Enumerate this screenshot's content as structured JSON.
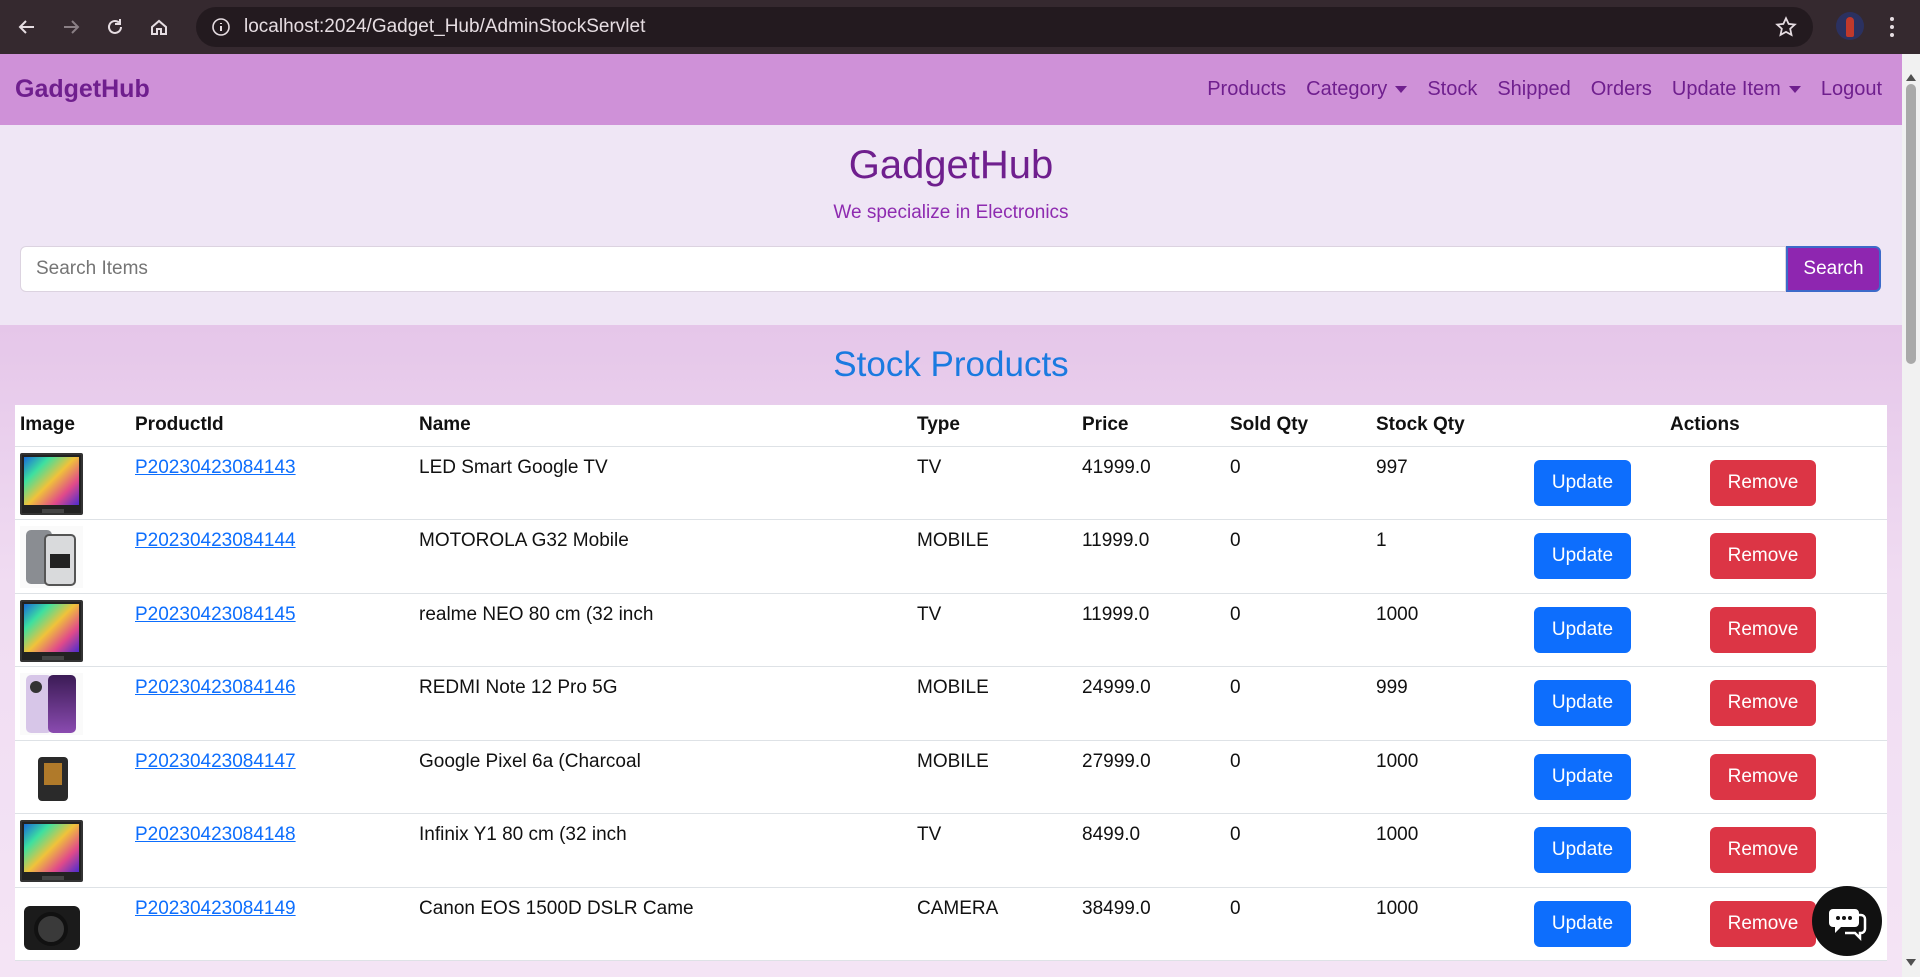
{
  "browser": {
    "url": "localhost:2024/Gadget_Hub/AdminStockServlet"
  },
  "navbar": {
    "brand": "GadgetHub",
    "links": {
      "products": "Products",
      "category": "Category",
      "stock": "Stock",
      "shipped": "Shipped",
      "orders": "Orders",
      "update_item": "Update Item",
      "logout": "Logout"
    }
  },
  "hero": {
    "title": "GadgetHub",
    "subtitle": "We specialize in Electronics",
    "search_placeholder": "Search Items",
    "search_button": "Search"
  },
  "stock": {
    "title": "Stock Products",
    "columns": {
      "image": "Image",
      "product_id": "ProductId",
      "name": "Name",
      "type": "Type",
      "price": "Price",
      "sold_qty": "Sold Qty",
      "stock_qty": "Stock Qty",
      "actions": "Actions"
    },
    "update_label": "Update",
    "remove_label": "Remove",
    "rows": [
      {
        "id": "P20230423084143",
        "name": "LED Smart Google TV",
        "type": "TV",
        "price": "41999.0",
        "sold": "0",
        "stock": "997",
        "thumb": "tv"
      },
      {
        "id": "P20230423084144",
        "name": "MOTOROLA G32 Mobile",
        "type": "MOBILE",
        "price": "11999.0",
        "sold": "0",
        "stock": "1",
        "thumb": "phone-grey"
      },
      {
        "id": "P20230423084145",
        "name": "realme NEO 80 cm (32 inch",
        "type": "TV",
        "price": "11999.0",
        "sold": "0",
        "stock": "1000",
        "thumb": "tv"
      },
      {
        "id": "P20230423084146",
        "name": "REDMI Note 12 Pro 5G",
        "type": "MOBILE",
        "price": "24999.0",
        "sold": "0",
        "stock": "999",
        "thumb": "phone-purple"
      },
      {
        "id": "P20230423084147",
        "name": "Google Pixel 6a (Charcoal",
        "type": "MOBILE",
        "price": "27999.0",
        "sold": "0",
        "stock": "1000",
        "thumb": "phone-dark"
      },
      {
        "id": "P20230423084148",
        "name": "Infinix Y1 80 cm (32 inch",
        "type": "TV",
        "price": "8499.0",
        "sold": "0",
        "stock": "1000",
        "thumb": "tv"
      },
      {
        "id": "P20230423084149",
        "name": "Canon EOS 1500D DSLR Came",
        "type": "CAMERA",
        "price": "38499.0",
        "sold": "0",
        "stock": "1000",
        "thumb": "camera"
      }
    ]
  },
  "colors": {
    "navbar_bg": "#cf91d8",
    "brand": "#6f1f8e",
    "accent_blue": "#0d6efd",
    "danger_red": "#dc3545",
    "search_btn": "#8e26b0"
  }
}
